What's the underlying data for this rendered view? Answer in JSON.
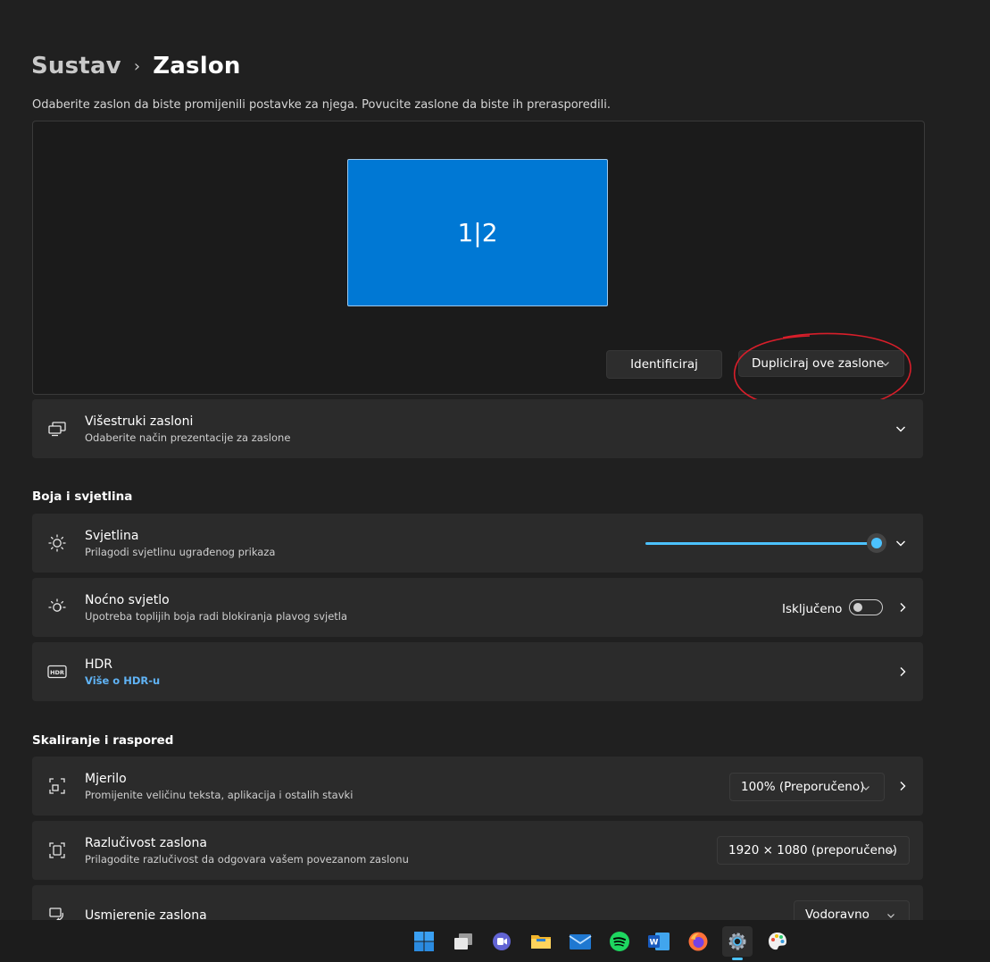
{
  "breadcrumb": {
    "parent": "Sustav",
    "separator": "›",
    "current": "Zaslon"
  },
  "instruction": "Odaberite zaslon da biste promijenili postavke za njega. Povucite zaslone da biste ih prerasporedili.",
  "arrangement": {
    "monitor_label": "1|2",
    "identify_button": "Identificiraj",
    "mode_select": "Dupliciraj ove zaslone"
  },
  "multiple_displays": {
    "title": "Višestruki zasloni",
    "subtitle": "Odaberite način prezentacije za zaslone"
  },
  "section_color": "Boja i svjetlina",
  "brightness": {
    "title": "Svjetlina",
    "subtitle": "Prilagodi svjetlinu ugrađenog prikaza",
    "value_percent": 100
  },
  "night_light": {
    "title": "Noćno svjetlo",
    "subtitle": "Upotreba toplijih boja radi blokiranja plavog svjetla",
    "state_label": "Isključeno",
    "on": false
  },
  "hdr": {
    "title": "HDR",
    "link": "Više o HDR-u"
  },
  "section_scale": "Skaliranje i raspored",
  "scale": {
    "title": "Mjerilo",
    "subtitle": "Promijenite veličinu teksta, aplikacija i ostalih stavki",
    "value": "100% (Preporučeno)"
  },
  "resolution": {
    "title": "Razlučivost zaslona",
    "subtitle": "Prilagodite  razlučivost da odgovara vašem povezanom zaslonu",
    "value": "1920 × 1080 (preporučeno)"
  },
  "orientation": {
    "title": "Usmjerenje zaslona",
    "value": "Vodoravno"
  },
  "colors": {
    "accent": "#0078d4",
    "slider": "#4cc2ff",
    "link": "#60b3f5",
    "annotation": "#d81e2a",
    "background": "#202020",
    "card": "#2b2b2b"
  },
  "taskbar": {
    "icons": [
      "start-icon",
      "task-view-icon",
      "teams-chat-icon",
      "file-explorer-icon",
      "mail-icon",
      "spotify-icon",
      "word-icon",
      "firefox-icon",
      "settings-icon",
      "paint-icon"
    ],
    "active": "settings-icon"
  }
}
